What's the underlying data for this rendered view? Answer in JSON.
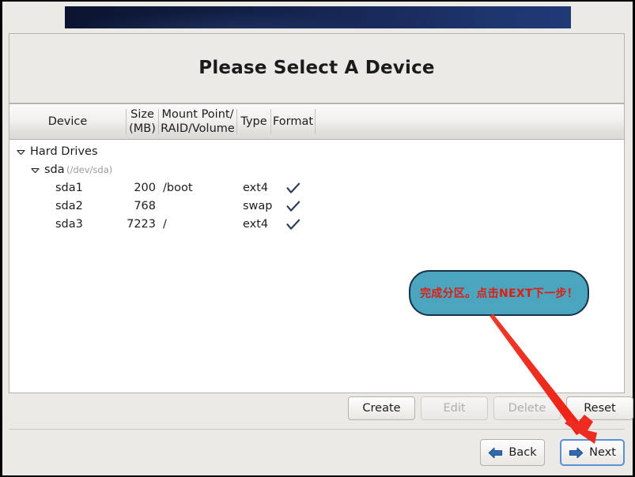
{
  "window": {
    "title": "Please Select A Device"
  },
  "table": {
    "columns": [
      {
        "label": "Device"
      },
      {
        "label": "Size\n(MB)",
        "line1": "Size",
        "line2": "(MB)"
      },
      {
        "label": "Mount Point/\nRAID/Volume",
        "line1": "Mount Point/",
        "line2": "RAID/Volume"
      },
      {
        "label": "Type"
      },
      {
        "label": "Format"
      }
    ],
    "rows": [
      {
        "kind": "group",
        "indent": 0,
        "expander": "triangle-down",
        "device": "Hard Drives",
        "detail": "",
        "size": "",
        "mount": "",
        "type": "",
        "format": false
      },
      {
        "kind": "drive",
        "indent": 1,
        "expander": "triangle-down",
        "device": "sda",
        "detail": "(/dev/sda)",
        "size": "",
        "mount": "",
        "type": "",
        "format": false
      },
      {
        "kind": "partition",
        "indent": 2,
        "expander": "",
        "device": "sda1",
        "detail": "",
        "size": "200",
        "mount": "/boot",
        "type": "ext4",
        "format": true
      },
      {
        "kind": "partition",
        "indent": 2,
        "expander": "",
        "device": "sda2",
        "detail": "",
        "size": "768",
        "mount": "",
        "type": "swap",
        "format": true
      },
      {
        "kind": "partition",
        "indent": 2,
        "expander": "",
        "device": "sda3",
        "detail": "",
        "size": "7223",
        "mount": "/",
        "type": "ext4",
        "format": true
      }
    ]
  },
  "actions": {
    "create": "Create",
    "edit": "Edit",
    "delete": "Delete",
    "reset": "Reset"
  },
  "navigation": {
    "back": "Back",
    "next": "Next"
  },
  "annotation": {
    "text": "完成分区。点击NEXT下一步！",
    "text_color": "#e01b10",
    "bubble_color": "#4ba5bf",
    "bubble_border_color": "#17324a",
    "arrow_color": "#ee2b20"
  },
  "colors": {
    "banner_dark": "#0b1430",
    "banner_light": "#203a78",
    "window_bg": "#eceae7",
    "list_bg": "#ffffff",
    "check_color": "#2b3a56",
    "nav_icon_blue": "#2f6cb5",
    "focus_ring": "#5b8fd6"
  }
}
